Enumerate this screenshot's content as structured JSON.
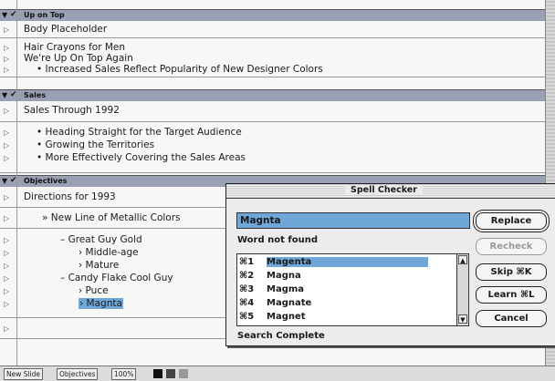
{
  "outline": {
    "sections": [
      {
        "title": "Up on Top",
        "groups": [
          [
            "Body Placeholder"
          ],
          [
            "Hair Crayons for Men",
            "We're Up On Top Again",
            "• Increased Sales Reflect Popularity of New Designer Colors"
          ]
        ]
      },
      {
        "title": "Sales",
        "groups": [
          [
            "Sales Through 1992"
          ],
          [
            "• Heading Straight for the Target Audience",
            "• Growing the Territories",
            "• More Effectively Covering the Sales Areas"
          ]
        ]
      },
      {
        "title": "Objectives",
        "groups": [
          [
            "Directions for 1993"
          ],
          [
            "» New Line of Metallic Colors"
          ],
          [
            "– Great Guy Gold",
            "› Middle-age",
            "› Mature",
            "– Candy Flake Cool Guy",
            "› Puce",
            "› Magnta"
          ]
        ]
      }
    ]
  },
  "status_bar": {
    "view": "New Slide",
    "section": "Objectives",
    "zoom": "100%"
  },
  "spell_checker": {
    "title": "Spell Checker",
    "word": "Magnta",
    "message": "Word not found",
    "suggestions": [
      {
        "key": "⌘1",
        "word": "Magenta"
      },
      {
        "key": "⌘2",
        "word": "Magna"
      },
      {
        "key": "⌘3",
        "word": "Magma"
      },
      {
        "key": "⌘4",
        "word": "Magnate"
      },
      {
        "key": "⌘5",
        "word": "Magnet"
      }
    ],
    "status": "Search Complete",
    "buttons": {
      "replace": "Replace",
      "recheck": "Recheck",
      "skip": "Skip ⌘K",
      "learn": "Learn ⌘L",
      "cancel": "Cancel"
    }
  },
  "colors": {
    "selection": "#6fa8d8",
    "header": "#9aa0b4"
  }
}
